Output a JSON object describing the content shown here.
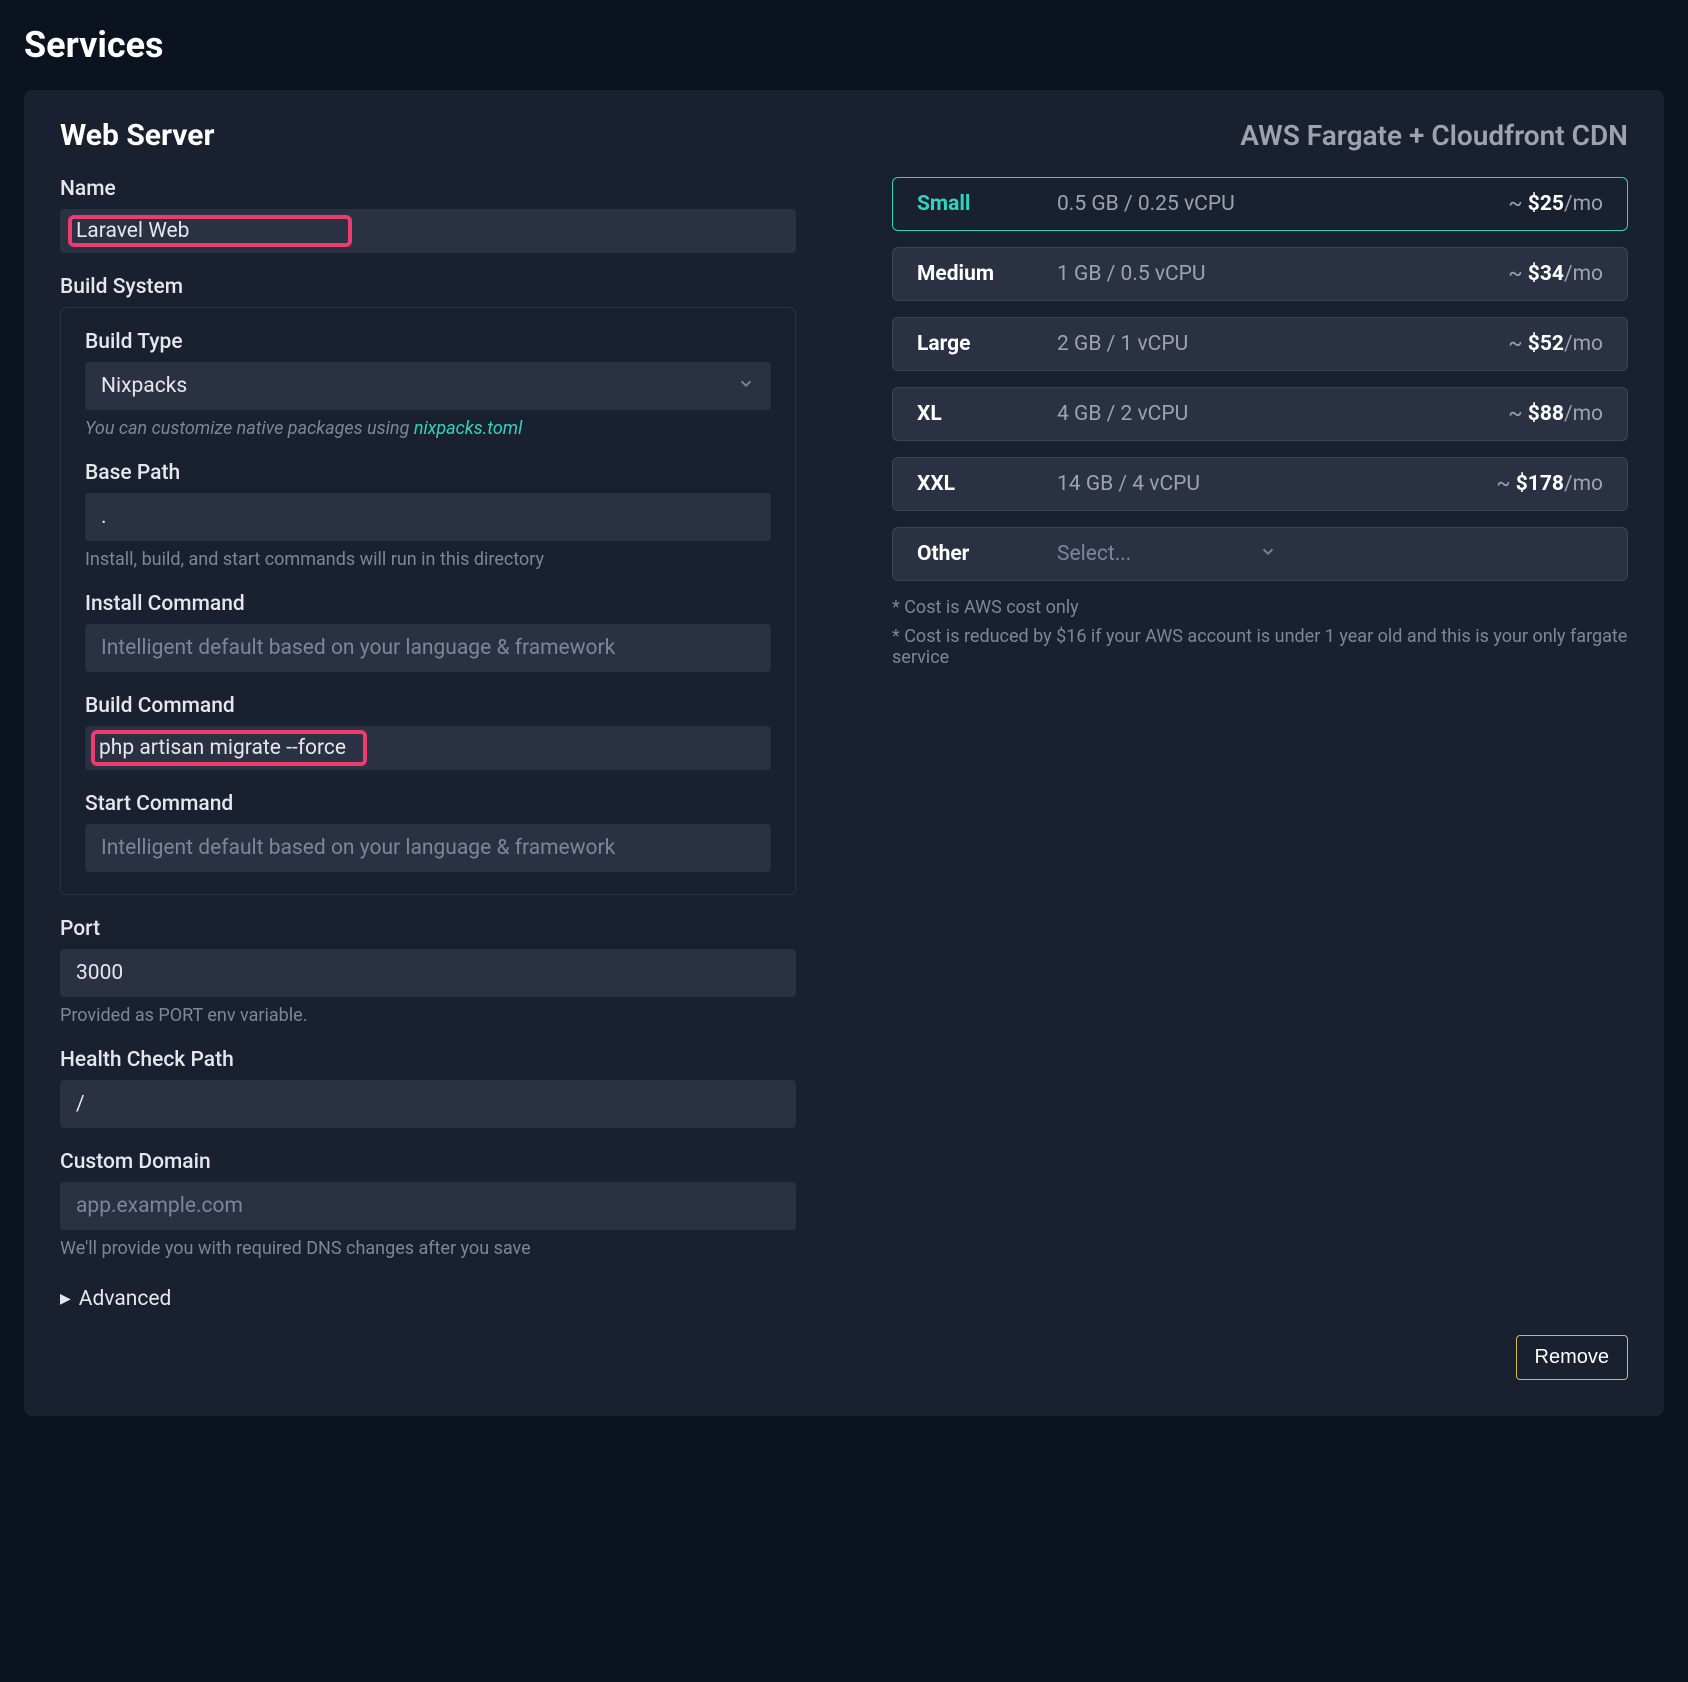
{
  "page": {
    "title": "Services"
  },
  "card": {
    "title": "Web Server",
    "subtitle": "AWS Fargate + Cloudfront CDN"
  },
  "form": {
    "name": {
      "label": "Name",
      "value": "Laravel Web"
    },
    "build_system": {
      "label": "Build System"
    },
    "build_type": {
      "label": "Build Type",
      "value": "Nixpacks",
      "hint_prefix": "You can customize native packages using ",
      "hint_link_text": "nixpacks.toml"
    },
    "base_path": {
      "label": "Base Path",
      "value": ".",
      "hint": "Install, build, and start commands will run in this directory"
    },
    "install_cmd": {
      "label": "Install Command",
      "placeholder": "Intelligent default based on your language & framework",
      "value": ""
    },
    "build_cmd": {
      "label": "Build Command",
      "value": "php artisan migrate --force"
    },
    "start_cmd": {
      "label": "Start Command",
      "placeholder": "Intelligent default based on your language & framework",
      "value": ""
    },
    "port": {
      "label": "Port",
      "value": "3000",
      "hint": "Provided as PORT env variable."
    },
    "health": {
      "label": "Health Check Path",
      "value": "/"
    },
    "domain": {
      "label": "Custom Domain",
      "placeholder": "app.example.com",
      "value": "",
      "hint": "We'll provide you with required DNS changes after you save"
    },
    "advanced_label": "Advanced"
  },
  "plans": {
    "items": [
      {
        "name": "Small",
        "spec": "0.5 GB / 0.25 vCPU",
        "price_prefix": "~ ",
        "price": "$25",
        "price_suffix": "/mo",
        "selected": true
      },
      {
        "name": "Medium",
        "spec": "1 GB / 0.5 vCPU",
        "price_prefix": "~ ",
        "price": "$34",
        "price_suffix": "/mo",
        "selected": false
      },
      {
        "name": "Large",
        "spec": "2 GB / 1 vCPU",
        "price_prefix": "~ ",
        "price": "$52",
        "price_suffix": "/mo",
        "selected": false
      },
      {
        "name": "XL",
        "spec": "4 GB / 2 vCPU",
        "price_prefix": "~ ",
        "price": "$88",
        "price_suffix": "/mo",
        "selected": false
      },
      {
        "name": "XXL",
        "spec": "14 GB / 4 vCPU",
        "price_prefix": "~ ",
        "price": "$178",
        "price_suffix": "/mo",
        "selected": false
      }
    ],
    "other": {
      "name": "Other",
      "select_placeholder": "Select..."
    },
    "note1": "* Cost is AWS cost only",
    "note2": "* Cost is reduced by $16 if your AWS account is under 1 year old and this is your only fargate service"
  },
  "footer": {
    "remove_label": "Remove"
  }
}
